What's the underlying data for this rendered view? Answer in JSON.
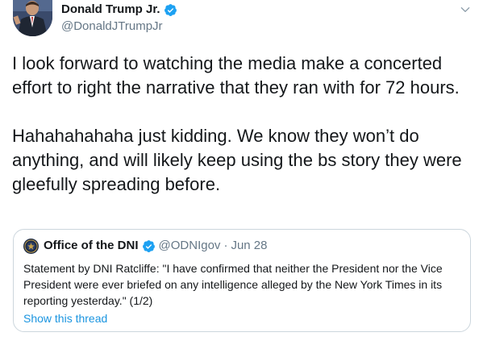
{
  "tweet": {
    "author": {
      "display_name": "Donald Trump Jr.",
      "handle": "@DonaldJTrumpJr",
      "verified": true
    },
    "text_paragraphs": [
      "I look forward to watching the media make a concerted effort to right the narrative that they ran with for 72 hours.",
      "Hahahahahaha just kidding. We know they won’t do anything, and will likely keep using the bs story they were gleefully spreading before."
    ],
    "quoted_tweet": {
      "display_name": "Office of the DNI",
      "handle": "@ODNIgov",
      "separator": "·",
      "date": "Jun 28",
      "verified": true,
      "text": "Statement by DNI Ratcliffe: \"I have confirmed that neither the President nor the Vice President were ever briefed on any intelligence alleged by the New York Times in its reporting yesterday.\" (1/2)",
      "show_thread_label": "Show this thread"
    },
    "menu_icon": "chevron-down-icon"
  },
  "colors": {
    "text_primary": "#14171a",
    "text_secondary": "#657786",
    "link": "#1b95e0",
    "verified_badge": "#1da1f2",
    "border": "#ccd6dd"
  }
}
